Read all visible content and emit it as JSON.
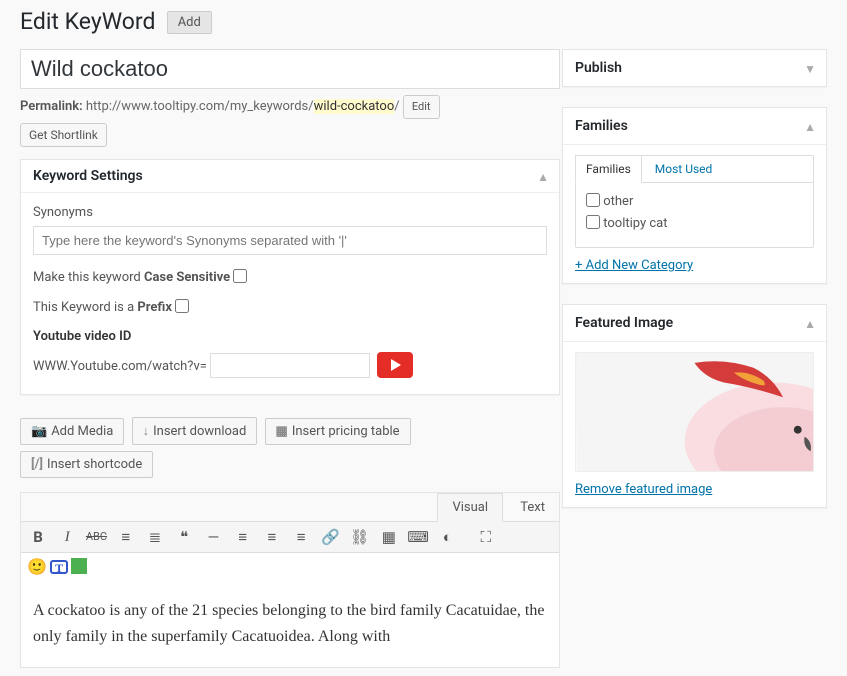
{
  "header": {
    "title": "Edit KeyWord",
    "add_btn": "Add"
  },
  "title_value": "Wild cockatoo",
  "permalink": {
    "label": "Permalink:",
    "base": "http://www.tooltipy.com/my_keywords/",
    "slug": "wild-cockatoo",
    "trail": "/",
    "edit_btn": "Edit",
    "shortlink_btn": "Get Shortlink"
  },
  "keyword_settings": {
    "title": "Keyword Settings",
    "synonyms_label": "Synonyms",
    "synonyms_placeholder": "Type here the keyword's Synonyms separated with '|'",
    "case_sensitive_pre": "Make this keyword ",
    "case_sensitive_bold": "Case Sensitive",
    "prefix_pre": "This Keyword is a ",
    "prefix_bold": "Prefix",
    "youtube_label": "Youtube video ID",
    "youtube_prefix": "WWW.Youtube.com/watch?v="
  },
  "media_buttons": {
    "add_media": "Add Media",
    "insert_download": "Insert download",
    "insert_pricing": "Insert pricing table",
    "insert_shortcode": "Insert shortcode"
  },
  "editor": {
    "tab_visual": "Visual",
    "tab_text": "Text",
    "content": "A cockatoo is any of the 21 species belonging to the bird family Cacatuidae, the only family in the superfamily Cacatuoidea. Along with"
  },
  "publish": {
    "title": "Publish"
  },
  "families": {
    "title": "Families",
    "tab_families": "Families",
    "tab_most_used": "Most Used",
    "items": [
      "other",
      "tooltipy cat"
    ],
    "add_new": "+ Add New Category"
  },
  "featured": {
    "title": "Featured Image",
    "remove": "Remove featured image"
  }
}
